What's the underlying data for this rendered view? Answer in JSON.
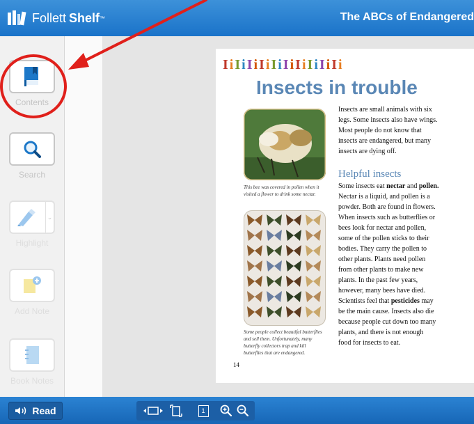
{
  "app": {
    "brand_name": "Follett",
    "brand_strong": "Shelf",
    "brand_tm": "™",
    "book_title": "The ABCs of Endangered"
  },
  "sidebar": {
    "contents_label": "Contents",
    "search_label": "Search",
    "highlight_label": "Highlight",
    "add_note_label": "Add Note",
    "book_notes_label": "Book Notes"
  },
  "page": {
    "decoration": "IiIiIiIiIiIiIiIiIiIi",
    "title": "Insects in trouble",
    "intro_lines": [
      "Insects are small animals with six",
      "legs. Some insects also have wings.",
      "Most people do not know that",
      "insects are endangered, but many",
      "insects are dying off."
    ],
    "subheading": "Helpful insects",
    "body_lines": [
      "Some insects eat nectar and pollen.",
      "Nectar is a liquid, and pollen is a",
      "powder. Both are found in flowers.",
      "When insects such as butterflies or",
      "bees look for nectar and pollen,",
      "some of the pollen sticks to their",
      "bodies. They carry the pollen to",
      "other plants. Plants need pollen",
      "from other plants to make new",
      "plants. In the past few years,",
      "however, many bees have died.",
      "Scientists feel that pesticides may",
      "be the main cause. Insects also die",
      "because people cut down too many",
      "plants, and there is not enough",
      "food for insects to eat."
    ],
    "caption_bee_lines": [
      "This bee was covered in pollen when it",
      "visited a flower to drink some nectar."
    ],
    "caption_butterfly_lines": [
      "Some people collect beautiful butterflies",
      "and sell them. Unfortunately, many",
      "butterfly collectors trap and kill",
      "butterflies that are endangered."
    ],
    "page_number": "14"
  },
  "toolbar": {
    "read_label": "Read",
    "page_box": "1"
  },
  "colors": {
    "header": "#1a73c9",
    "accent_title": "#5a87b5",
    "annotation_red": "#e0201b"
  }
}
